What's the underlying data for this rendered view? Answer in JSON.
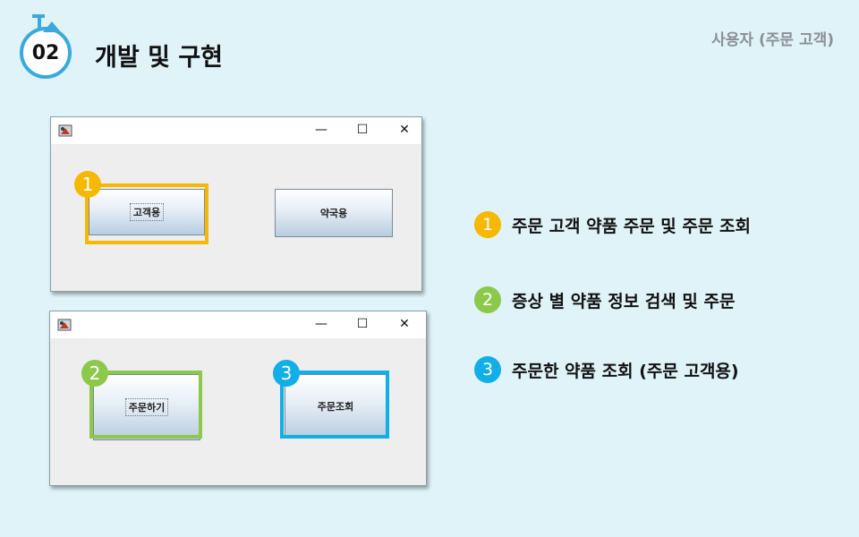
{
  "header": {
    "section_number": "02",
    "section_title": "개발 및 구현",
    "role_label": "사용자 (주문 고객)"
  },
  "colors": {
    "accent_blue": "#3aa9dc",
    "marker_1": "#f6b800",
    "marker_2": "#8cc84b",
    "marker_3": "#12aee8"
  },
  "window1": {
    "controls": {
      "minimize": "—",
      "maximize": "☐",
      "close": "✕"
    },
    "customer_button": "고객용",
    "pharmacy_button": "약국용",
    "marker": "1"
  },
  "window2": {
    "controls": {
      "minimize": "—",
      "maximize": "☐",
      "close": "✕"
    },
    "order_button": "주문하기",
    "order_lookup_button": "주문조회",
    "marker_order": "2",
    "marker_lookup": "3"
  },
  "legend": [
    {
      "num": "1",
      "text": "주문 고객 약품 주문 및 주문 조회"
    },
    {
      "num": "2",
      "text": "증상 별 약품 정보 검색 및 주문"
    },
    {
      "num": "3",
      "text": "주문한 약품 조회 (주문 고객용)"
    }
  ]
}
